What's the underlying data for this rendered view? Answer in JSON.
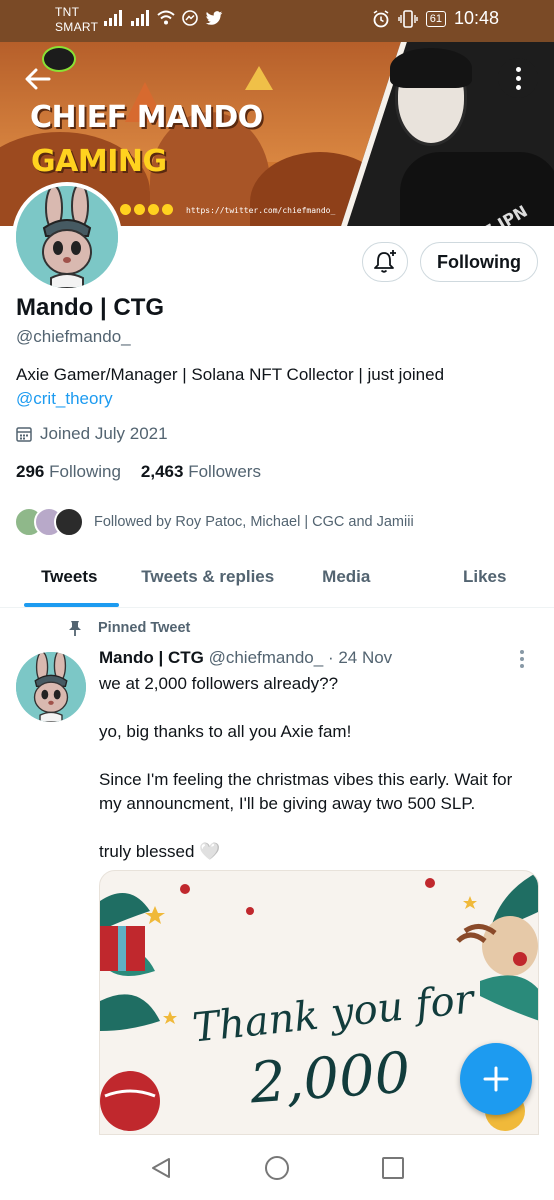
{
  "status_bar": {
    "carrier_line1": "TNT",
    "carrier_line2": "SMART",
    "battery": "61",
    "time": "10:48"
  },
  "banner": {
    "title_line1": "CHIEF MANDO",
    "title_line2": "GAMING",
    "url": "https://twitter.com/chiefmando_",
    "photo_brand_text": "NIKE JPN",
    "colors": {
      "primary": "#c8732f",
      "title_yellow": "#ffd21f"
    }
  },
  "profile": {
    "name": "Mando | CTG",
    "handle": "@chiefmando_",
    "bio_text": "Axie Gamer/Manager | Solana NFT Collector | just joined",
    "bio_link": "@crit_theory",
    "joined": "Joined July 2021",
    "following_count": "296",
    "following_label": "Following",
    "followers_count": "2,463",
    "followers_label": "Followers",
    "followed_by": "Followed by Roy Patoc, Michael | CGC and Jamiii",
    "follow_button_label": "Following"
  },
  "tabs": [
    {
      "label": "Tweets",
      "active": true
    },
    {
      "label": "Tweets & replies",
      "active": false
    },
    {
      "label": "Media",
      "active": false
    },
    {
      "label": "Likes",
      "active": false
    }
  ],
  "tweet": {
    "pinned_label": "Pinned Tweet",
    "author_name": "Mando | CTG",
    "author_handle": "@chiefmando_",
    "date": "· 24 Nov",
    "body": "we at 2,000 followers already??\n\nyo, big thanks to all you Axie fam!\n\nSince I'm feeling the christmas vibes this early. Wait for my announcment, I'll be giving away two 500 SLP.\n\ntruly blessed 🤍",
    "card_text_line1": "Thank you for",
    "card_text_line2": "2,000"
  },
  "accent_color": "#1d9bf0"
}
